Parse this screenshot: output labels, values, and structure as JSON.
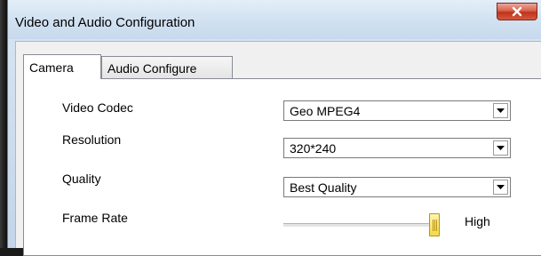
{
  "window": {
    "title": "Video and Audio Configuration",
    "close_label": "X"
  },
  "tabs": [
    {
      "label": "Camera",
      "active": true
    },
    {
      "label": "Audio Configure",
      "active": false
    }
  ],
  "settings": {
    "video_codec": {
      "label": "Video Codec",
      "value": "Geo MPEG4"
    },
    "resolution": {
      "label": "Resolution",
      "value": "320*240"
    },
    "quality": {
      "label": "Quality",
      "value": "Best Quality"
    },
    "frame_rate": {
      "label": "Frame Rate",
      "level": 1.0,
      "level_label": "High"
    }
  },
  "colors": {
    "accent_close": "#c1321a",
    "slider_thumb": "#f3d84a"
  }
}
